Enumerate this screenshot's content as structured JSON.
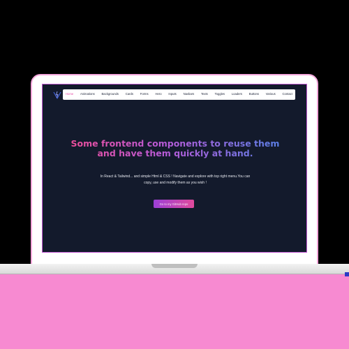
{
  "navbar": {
    "items": [
      {
        "label": "Home"
      },
      {
        "label": "Animations"
      },
      {
        "label": "Backgrounds"
      },
      {
        "label": "Cards"
      },
      {
        "label": "Forms"
      },
      {
        "label": "Hero"
      },
      {
        "label": "Inputs"
      },
      {
        "label": "Navbars"
      },
      {
        "label": "Texts"
      },
      {
        "label": "Toggles"
      },
      {
        "label": "Loaders"
      },
      {
        "label": "Buttons"
      },
      {
        "label": "Various"
      },
      {
        "label": "Contact"
      }
    ],
    "active_index": 0
  },
  "hero": {
    "title": "Some frontend components to reuse them and have them quickly at hand.",
    "description": "In React & Tailwind... and simple Html & CSS ! Navigate and explore with top right menu.You can copy, use and modify them as you wish !",
    "cta_label": "Go to my GitHub repo"
  },
  "colors": {
    "screen_bg": "#131a2c",
    "accent_pink": "#ee4f9c",
    "accent_blue": "#5b7fe6",
    "backdrop_pink": "#f78ad1"
  },
  "icons": {
    "logo": "vite-logo-icon"
  }
}
